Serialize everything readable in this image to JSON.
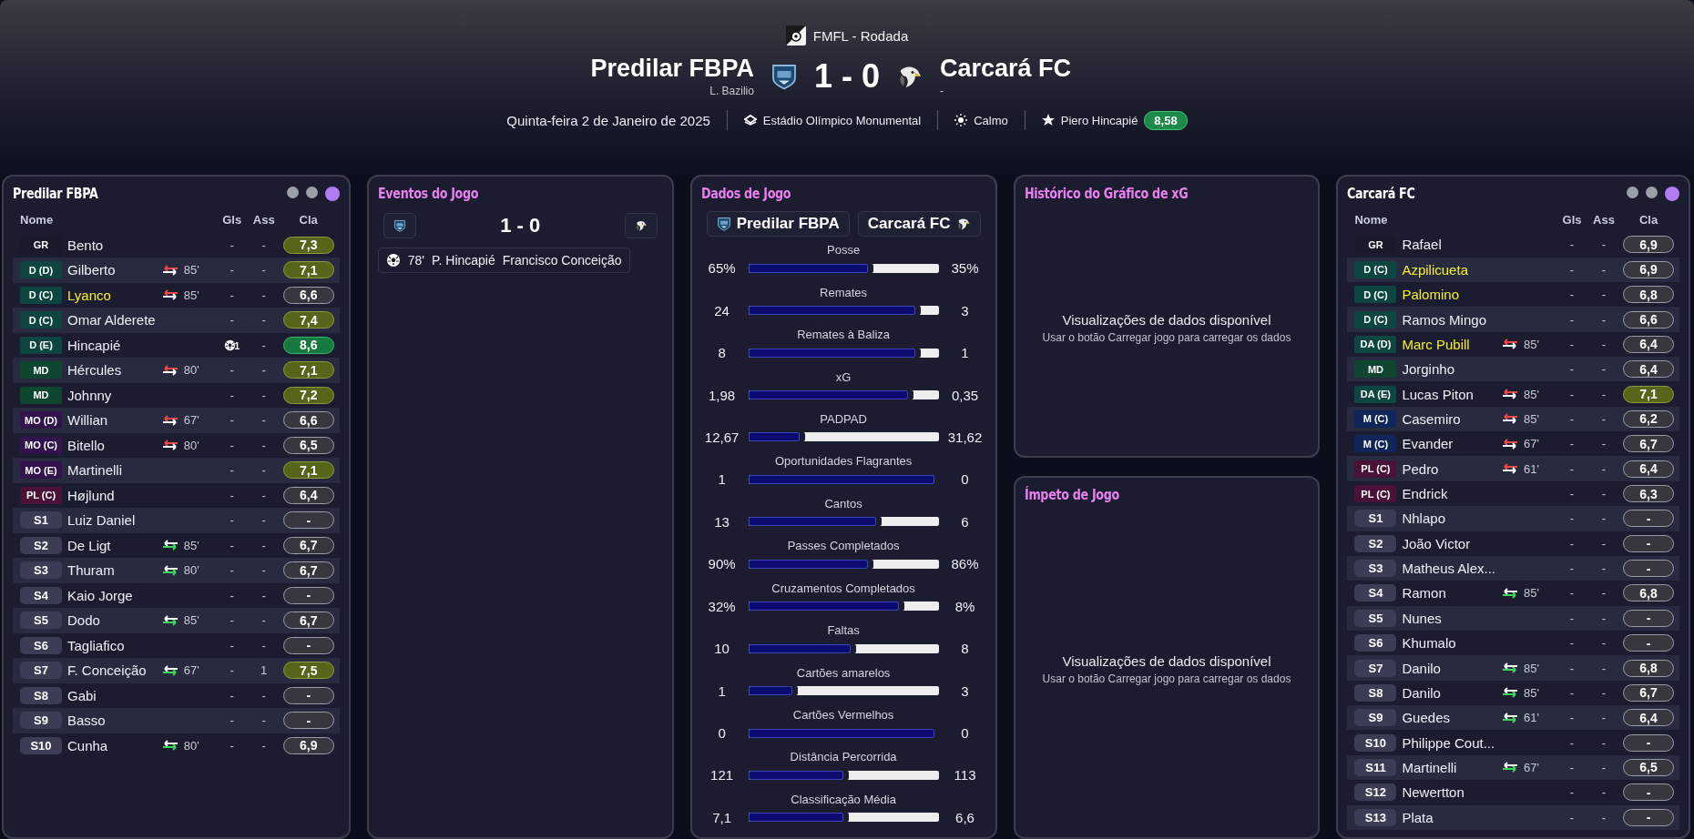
{
  "header": {
    "competition": "FMFL - Rodada",
    "home": {
      "name": "Predilar FBPA",
      "manager": "L. Bazilio"
    },
    "score": "1 - 0",
    "away": {
      "name": "Carcará FC",
      "manager": "-"
    },
    "date": "Quinta-feira 2 de Janeiro de 2025",
    "stadium": "Estádio Olímpico Monumental",
    "weather": "Calmo",
    "player_of_match": "Piero Hincapié",
    "player_of_match_rating": "8,58"
  },
  "home_lineup": {
    "title": "Predilar FBPA",
    "view_dots": [
      {
        "selected": false
      },
      {
        "selected": false
      },
      {
        "selected": true
      }
    ],
    "columns": [
      "Nome",
      "Gls",
      "Ass",
      "Cla"
    ],
    "players": [
      {
        "position": {
          "label": "GR",
          "kind": "gk"
        },
        "name": "Bento",
        "highlighted": false,
        "goals": "-",
        "scored": false,
        "assists": "-",
        "rating": {
          "value": "7,3",
          "kind": "good"
        }
      },
      {
        "position": {
          "label": "D (D)",
          "kind": "def"
        },
        "name": "Gilberto",
        "highlighted": false,
        "substitution": {
          "kind": "off",
          "minute": "85'"
        },
        "goals": "-",
        "scored": false,
        "assists": "-",
        "rating": {
          "value": "7,1",
          "kind": "good"
        }
      },
      {
        "position": {
          "label": "D (C)",
          "kind": "def"
        },
        "name": "Lyanco",
        "highlighted": true,
        "substitution": {
          "kind": "off",
          "minute": "85'"
        },
        "goals": "-",
        "scored": false,
        "assists": "-",
        "rating": {
          "value": "6,6",
          "kind": "plain"
        }
      },
      {
        "position": {
          "label": "D (C)",
          "kind": "def"
        },
        "name": "Omar Alderete",
        "highlighted": false,
        "goals": "-",
        "scored": false,
        "assists": "-",
        "rating": {
          "value": "7,4",
          "kind": "good"
        }
      },
      {
        "position": {
          "label": "D (E)",
          "kind": "def"
        },
        "name": "Hincapié",
        "highlighted": false,
        "goals": "1",
        "scored": true,
        "assists": "-",
        "rating": {
          "value": "8,6",
          "kind": "great"
        }
      },
      {
        "position": {
          "label": "MD",
          "kind": "dm"
        },
        "name": "Hércules",
        "highlighted": false,
        "substitution": {
          "kind": "off",
          "minute": "80'"
        },
        "goals": "-",
        "scored": false,
        "assists": "-",
        "rating": {
          "value": "7,1",
          "kind": "good"
        }
      },
      {
        "position": {
          "label": "MD",
          "kind": "dm"
        },
        "name": "Johnny",
        "highlighted": false,
        "goals": "-",
        "scored": false,
        "assists": "-",
        "rating": {
          "value": "7,2",
          "kind": "good"
        }
      },
      {
        "position": {
          "label": "MO (D)",
          "kind": "am"
        },
        "name": "Willian",
        "highlighted": false,
        "substitution": {
          "kind": "off",
          "minute": "67'"
        },
        "goals": "-",
        "scored": false,
        "assists": "-",
        "rating": {
          "value": "6,6",
          "kind": "plain"
        }
      },
      {
        "position": {
          "label": "MO (C)",
          "kind": "am"
        },
        "name": "Bitello",
        "highlighted": false,
        "substitution": {
          "kind": "off",
          "minute": "80'"
        },
        "goals": "-",
        "scored": false,
        "assists": "-",
        "rating": {
          "value": "6,5",
          "kind": "plain"
        }
      },
      {
        "position": {
          "label": "MO (E)",
          "kind": "am"
        },
        "name": "Martinelli",
        "highlighted": false,
        "goals": "-",
        "scored": false,
        "assists": "-",
        "rating": {
          "value": "7,1",
          "kind": "good"
        }
      },
      {
        "position": {
          "label": "PL (C)",
          "kind": "fw"
        },
        "name": "Højlund",
        "highlighted": false,
        "goals": "-",
        "scored": false,
        "assists": "-",
        "rating": {
          "value": "6,4",
          "kind": "plain"
        }
      },
      {
        "position": {
          "label": "S1",
          "kind": "sub"
        },
        "name": "Luiz Daniel",
        "highlighted": false,
        "goals": "-",
        "scored": false,
        "assists": "-",
        "rating": {
          "value": "-",
          "kind": "plain"
        }
      },
      {
        "position": {
          "label": "S2",
          "kind": "sub"
        },
        "name": "De Ligt",
        "highlighted": false,
        "substitution": {
          "kind": "on",
          "minute": "85'"
        },
        "goals": "-",
        "scored": false,
        "assists": "-",
        "rating": {
          "value": "6,7",
          "kind": "plain"
        }
      },
      {
        "position": {
          "label": "S3",
          "kind": "sub"
        },
        "name": "Thuram",
        "highlighted": false,
        "substitution": {
          "kind": "on",
          "minute": "80'"
        },
        "goals": "-",
        "scored": false,
        "assists": "-",
        "rating": {
          "value": "6,7",
          "kind": "plain"
        }
      },
      {
        "position": {
          "label": "S4",
          "kind": "sub"
        },
        "name": "Kaio Jorge",
        "highlighted": false,
        "goals": "-",
        "scored": false,
        "assists": "-",
        "rating": {
          "value": "-",
          "kind": "plain"
        }
      },
      {
        "position": {
          "label": "S5",
          "kind": "sub"
        },
        "name": "Dodo",
        "highlighted": false,
        "substitution": {
          "kind": "on",
          "minute": "85'"
        },
        "goals": "-",
        "scored": false,
        "assists": "-",
        "rating": {
          "value": "6,7",
          "kind": "plain"
        }
      },
      {
        "position": {
          "label": "S6",
          "kind": "sub"
        },
        "name": "Tagliafico",
        "highlighted": false,
        "goals": "-",
        "scored": false,
        "assists": "-",
        "rating": {
          "value": "-",
          "kind": "plain"
        }
      },
      {
        "position": {
          "label": "S7",
          "kind": "sub"
        },
        "name": "F. Conceição",
        "highlighted": false,
        "substitution": {
          "kind": "on",
          "minute": "67'"
        },
        "goals": "-",
        "scored": false,
        "assists": "1",
        "rating": {
          "value": "7,5",
          "kind": "good"
        }
      },
      {
        "position": {
          "label": "S8",
          "kind": "sub"
        },
        "name": "Gabi",
        "highlighted": false,
        "goals": "-",
        "scored": false,
        "assists": "-",
        "rating": {
          "value": "-",
          "kind": "plain"
        }
      },
      {
        "position": {
          "label": "S9",
          "kind": "sub"
        },
        "name": "Basso",
        "highlighted": false,
        "goals": "-",
        "scored": false,
        "assists": "-",
        "rating": {
          "value": "-",
          "kind": "plain"
        }
      },
      {
        "position": {
          "label": "S10",
          "kind": "sub"
        },
        "name": "Cunha",
        "highlighted": false,
        "substitution": {
          "kind": "on",
          "minute": "80'"
        },
        "goals": "-",
        "scored": false,
        "assists": "-",
        "rating": {
          "value": "6,9",
          "kind": "plain"
        }
      }
    ]
  },
  "events": {
    "title": "Eventos do Jogo",
    "score": "1 - 0",
    "items": [
      {
        "kind": "goal",
        "minute": "78'",
        "scorer": "P. Hincapié",
        "assist": "Francisco Conceição"
      }
    ]
  },
  "match_stats": {
    "title": "Dados de Jogo",
    "home": "Predilar FBPA",
    "away": "Carcará FC",
    "rows": [
      {
        "label": "Posse",
        "home": "65%",
        "away": "35%",
        "level": 0.63
      },
      {
        "label": "Remates",
        "home": "24",
        "away": "3",
        "level": 0.88
      },
      {
        "label": "Remates à Baliza",
        "home": "8",
        "away": "1",
        "level": 0.88
      },
      {
        "label": "xG",
        "home": "1,98",
        "away": "0,35",
        "level": 0.84
      },
      {
        "label": "PADPAD",
        "home": "12,67",
        "away": "31,62",
        "level": 0.27
      },
      {
        "label": "Oportunidades Flagrantes",
        "home": "1",
        "away": "0",
        "level": 0.98
      },
      {
        "label": "Cantos",
        "home": "13",
        "away": "6",
        "level": 0.67
      },
      {
        "label": "Passes Completados",
        "home": "90%",
        "away": "86%",
        "level": 0.63
      },
      {
        "label": "Cruzamentos Completados",
        "home": "32%",
        "away": "8%",
        "level": 0.79
      },
      {
        "label": "Faltas",
        "home": "10",
        "away": "8",
        "level": 0.54
      },
      {
        "label": "Cartões amarelos",
        "home": "1",
        "away": "3",
        "level": 0.23
      },
      {
        "label": "Cartões Vermelhos",
        "home": "0",
        "away": "0",
        "level": 0.98
      },
      {
        "label": "Distância Percorrida",
        "home": "121",
        "away": "113",
        "level": 0.5
      },
      {
        "label": "Classificação Média",
        "home": "7,1",
        "away": "6,6",
        "level": 0.5
      }
    ]
  },
  "xg_history": {
    "title": "Histórico do Gráfico de xG",
    "message": "Visualizações de dados disponível",
    "hint": "Usar o botão Carregar jogo para carregar os dados"
  },
  "momentum": {
    "title": "Ímpeto de Jogo",
    "message": "Visualizações de dados disponível",
    "hint": "Usar o botão Carregar jogo para carregar os dados"
  },
  "away_lineup": {
    "title": "Carcará FC",
    "view_dots": [
      {
        "selected": false
      },
      {
        "selected": false
      },
      {
        "selected": true
      }
    ],
    "columns": [
      "Nome",
      "Gls",
      "Ass",
      "Cla"
    ],
    "players": [
      {
        "position": {
          "label": "GR",
          "kind": "gk"
        },
        "name": "Rafael",
        "highlighted": false,
        "goals": "-",
        "scored": false,
        "assists": "-",
        "rating": {
          "value": "6,9",
          "kind": "plain"
        }
      },
      {
        "position": {
          "label": "D (C)",
          "kind": "def"
        },
        "name": "Azpilicueta",
        "highlighted": true,
        "goals": "-",
        "scored": false,
        "assists": "-",
        "rating": {
          "value": "6,9",
          "kind": "plain"
        }
      },
      {
        "position": {
          "label": "D (C)",
          "kind": "def"
        },
        "name": "Palomino",
        "highlighted": true,
        "goals": "-",
        "scored": false,
        "assists": "-",
        "rating": {
          "value": "6,8",
          "kind": "plain"
        }
      },
      {
        "position": {
          "label": "D (C)",
          "kind": "def"
        },
        "name": "Ramos Mingo",
        "highlighted": false,
        "goals": "-",
        "scored": false,
        "assists": "-",
        "rating": {
          "value": "6,6",
          "kind": "plain"
        }
      },
      {
        "position": {
          "label": "DA (D)",
          "kind": "def"
        },
        "name": "Marc Pubill",
        "highlighted": true,
        "substitution": {
          "kind": "off",
          "minute": "85'"
        },
        "goals": "-",
        "scored": false,
        "assists": "-",
        "rating": {
          "value": "6,4",
          "kind": "plain"
        }
      },
      {
        "position": {
          "label": "MD",
          "kind": "dm"
        },
        "name": "Jorginho",
        "highlighted": false,
        "goals": "-",
        "scored": false,
        "assists": "-",
        "rating": {
          "value": "6,4",
          "kind": "plain"
        }
      },
      {
        "position": {
          "label": "DA (E)",
          "kind": "def"
        },
        "name": "Lucas Piton",
        "highlighted": false,
        "substitution": {
          "kind": "off",
          "minute": "85'"
        },
        "goals": "-",
        "scored": false,
        "assists": "-",
        "rating": {
          "value": "7,1",
          "kind": "good"
        }
      },
      {
        "position": {
          "label": "M (C)",
          "kind": "mid"
        },
        "name": "Casemiro",
        "highlighted": false,
        "substitution": {
          "kind": "off",
          "minute": "85'"
        },
        "goals": "-",
        "scored": false,
        "assists": "-",
        "rating": {
          "value": "6,2",
          "kind": "plain"
        }
      },
      {
        "position": {
          "label": "M (C)",
          "kind": "mid"
        },
        "name": "Evander",
        "highlighted": false,
        "substitution": {
          "kind": "off",
          "minute": "67'"
        },
        "goals": "-",
        "scored": false,
        "assists": "-",
        "rating": {
          "value": "6,7",
          "kind": "plain"
        }
      },
      {
        "position": {
          "label": "PL (C)",
          "kind": "fw"
        },
        "name": "Pedro",
        "highlighted": false,
        "substitution": {
          "kind": "off",
          "minute": "61'"
        },
        "goals": "-",
        "scored": false,
        "assists": "-",
        "rating": {
          "value": "6,4",
          "kind": "plain"
        }
      },
      {
        "position": {
          "label": "PL (C)",
          "kind": "fw"
        },
        "name": "Endrick",
        "highlighted": false,
        "goals": "-",
        "scored": false,
        "assists": "-",
        "rating": {
          "value": "6,3",
          "kind": "plain"
        }
      },
      {
        "position": {
          "label": "S1",
          "kind": "sub"
        },
        "name": "Nhlapo",
        "highlighted": false,
        "goals": "-",
        "scored": false,
        "assists": "-",
        "rating": {
          "value": "-",
          "kind": "plain"
        }
      },
      {
        "position": {
          "label": "S2",
          "kind": "sub"
        },
        "name": "João Victor",
        "highlighted": false,
        "goals": "-",
        "scored": false,
        "assists": "-",
        "rating": {
          "value": "-",
          "kind": "plain"
        }
      },
      {
        "position": {
          "label": "S3",
          "kind": "sub"
        },
        "name": "Matheus Alex...",
        "highlighted": false,
        "goals": "-",
        "scored": false,
        "assists": "-",
        "rating": {
          "value": "-",
          "kind": "plain"
        }
      },
      {
        "position": {
          "label": "S4",
          "kind": "sub"
        },
        "name": "Ramon",
        "highlighted": false,
        "substitution": {
          "kind": "on",
          "minute": "85'"
        },
        "goals": "-",
        "scored": false,
        "assists": "-",
        "rating": {
          "value": "6,8",
          "kind": "plain"
        }
      },
      {
        "position": {
          "label": "S5",
          "kind": "sub"
        },
        "name": "Nunes",
        "highlighted": false,
        "goals": "-",
        "scored": false,
        "assists": "-",
        "rating": {
          "value": "-",
          "kind": "plain"
        }
      },
      {
        "position": {
          "label": "S6",
          "kind": "sub"
        },
        "name": "Khumalo",
        "highlighted": false,
        "goals": "-",
        "scored": false,
        "assists": "-",
        "rating": {
          "value": "-",
          "kind": "plain"
        }
      },
      {
        "position": {
          "label": "S7",
          "kind": "sub"
        },
        "name": "Danilo",
        "highlighted": false,
        "substitution": {
          "kind": "on",
          "minute": "85'"
        },
        "goals": "-",
        "scored": false,
        "assists": "-",
        "rating": {
          "value": "6,8",
          "kind": "plain"
        }
      },
      {
        "position": {
          "label": "S8",
          "kind": "sub"
        },
        "name": "Danilo",
        "highlighted": false,
        "substitution": {
          "kind": "on",
          "minute": "85'"
        },
        "goals": "-",
        "scored": false,
        "assists": "-",
        "rating": {
          "value": "6,7",
          "kind": "plain"
        }
      },
      {
        "position": {
          "label": "S9",
          "kind": "sub"
        },
        "name": "Guedes",
        "highlighted": false,
        "substitution": {
          "kind": "on",
          "minute": "61'"
        },
        "goals": "-",
        "scored": false,
        "assists": "-",
        "rating": {
          "value": "6,4",
          "kind": "plain"
        }
      },
      {
        "position": {
          "label": "S10",
          "kind": "sub"
        },
        "name": "Philippe Cout...",
        "highlighted": false,
        "goals": "-",
        "scored": false,
        "assists": "-",
        "rating": {
          "value": "-",
          "kind": "plain"
        }
      },
      {
        "position": {
          "label": "S11",
          "kind": "sub"
        },
        "name": "Martinelli",
        "highlighted": false,
        "substitution": {
          "kind": "on",
          "minute": "67'"
        },
        "goals": "-",
        "scored": false,
        "assists": "-",
        "rating": {
          "value": "6,5",
          "kind": "plain"
        }
      },
      {
        "position": {
          "label": "S12",
          "kind": "sub"
        },
        "name": "Newertton",
        "highlighted": false,
        "goals": "-",
        "scored": false,
        "assists": "-",
        "rating": {
          "value": "-",
          "kind": "plain"
        }
      },
      {
        "position": {
          "label": "S13",
          "kind": "sub"
        },
        "name": "Plata",
        "highlighted": false,
        "goals": "-",
        "scored": false,
        "assists": "-",
        "rating": {
          "value": "-",
          "kind": "plain"
        }
      }
    ]
  }
}
